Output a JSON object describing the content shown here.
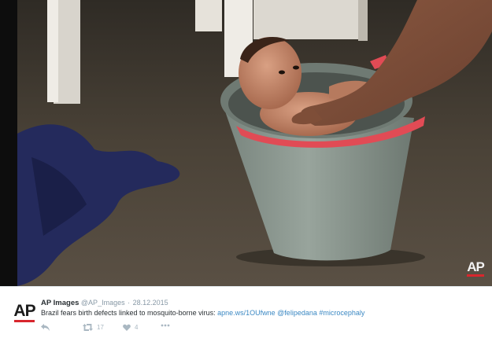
{
  "photo": {
    "alt_subject": "photo",
    "watermark": "AP"
  },
  "tweet": {
    "avatar_text": "AP",
    "author_name": "AP Images",
    "handle": "@AP_Images",
    "separator": "·",
    "date": "28.12.2015",
    "text_prefix": "Brazil fears birth defects linked to mosquito-borne virus: ",
    "link_url": "apne.ws/1OUfwne",
    "mention": "@felipedana",
    "hashtag": "#microcephaly",
    "retweet_count": "17",
    "like_count": "4"
  },
  "icons": {
    "reply": "reply-icon",
    "retweet": "retweet-icon",
    "like": "heart-icon",
    "more": "more-icon"
  },
  "colors": {
    "brand_red": "#d8262d",
    "link_blue": "#3b88c3",
    "text": "#292f33",
    "muted": "#8899a6"
  }
}
